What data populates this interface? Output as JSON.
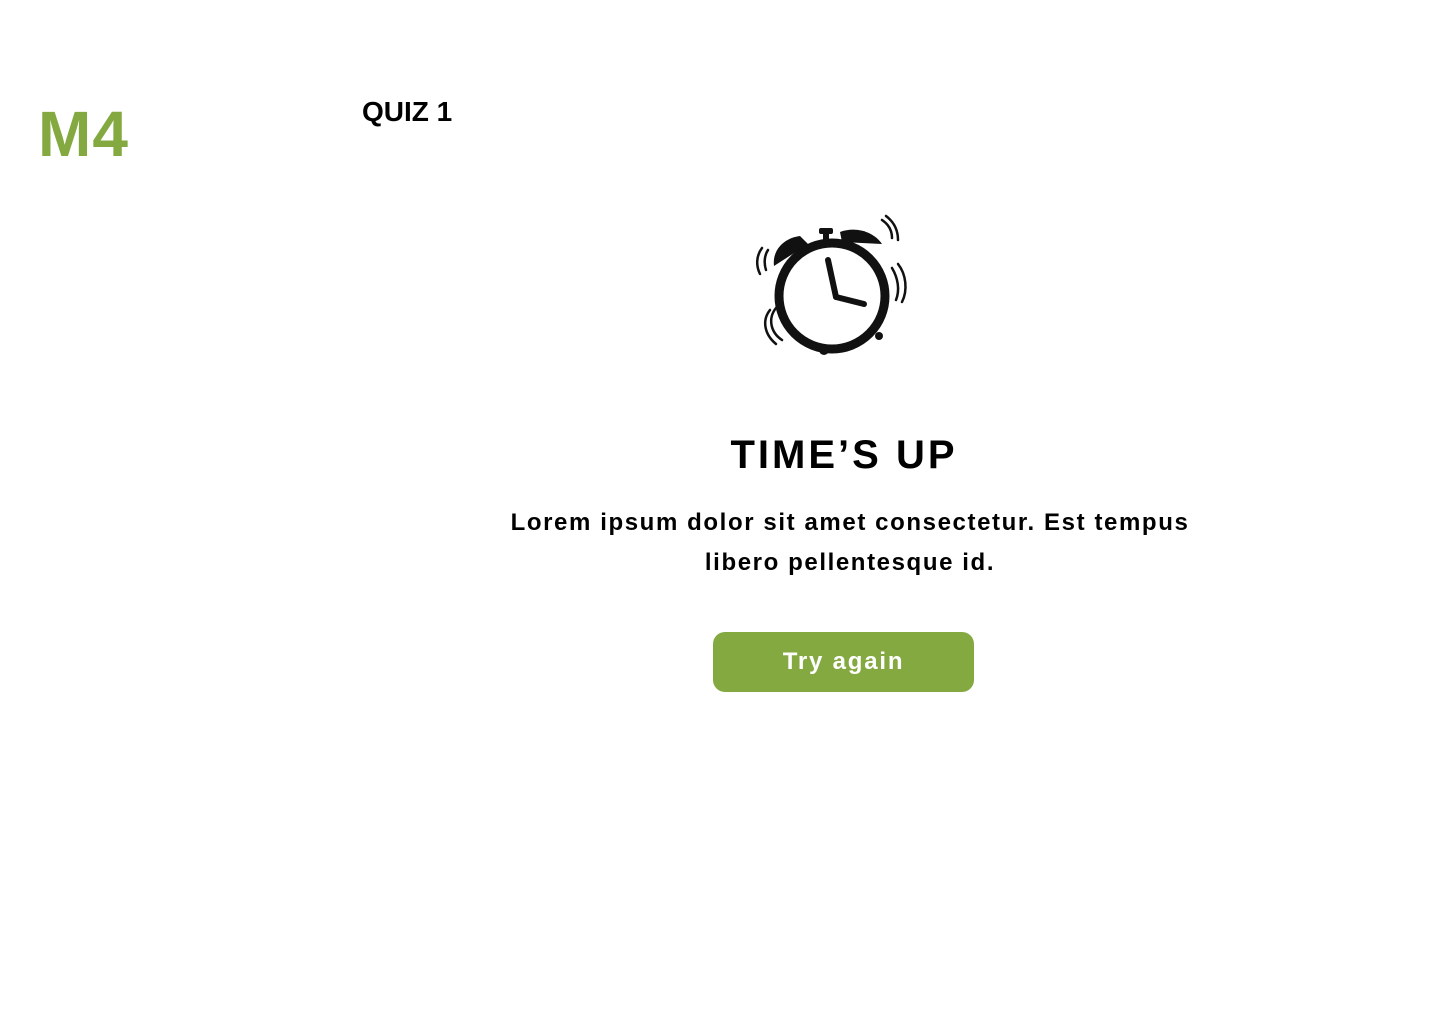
{
  "brand": {
    "logo_text": "M4",
    "accent_color": "#83a940"
  },
  "header": {
    "quiz_title": "QUIZ 1"
  },
  "result": {
    "icon": "alarm-clock-ringing-icon",
    "heading": "TIME’S UP",
    "message": "Lorem ipsum dolor sit amet consectetur. Est tempus libero pellentesque id.",
    "button_label": "Try again"
  }
}
